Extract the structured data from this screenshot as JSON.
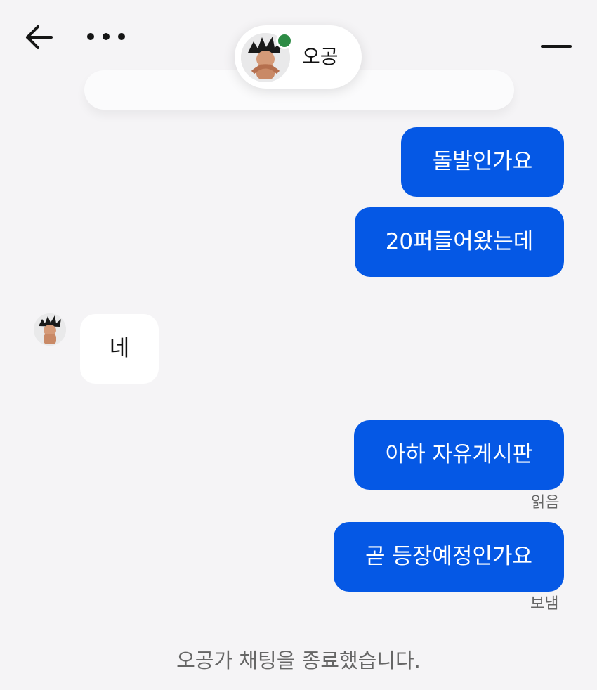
{
  "header": {
    "back_icon": "arrow-left-icon",
    "more_icon": "more-dots-icon",
    "minimize_icon": "minimize-icon",
    "profile": {
      "name": "오공",
      "online_color": "#2d8c45"
    }
  },
  "messages": [
    {
      "direction": "sent",
      "text": "돌발인가요"
    },
    {
      "direction": "sent",
      "text": "20퍼들어왔는데"
    },
    {
      "direction": "received",
      "text": "네"
    },
    {
      "direction": "sent",
      "text": "아하 자유게시판",
      "status": "읽음"
    },
    {
      "direction": "sent",
      "text": "곧 등장예정인가요",
      "status": "보냄"
    }
  ],
  "system_message": "오공가 채팅을 종료했습니다.",
  "colors": {
    "sent_bubble": "#0558e5",
    "received_bubble": "#ffffff",
    "background": "#f5f4f6",
    "status_text": "#666666"
  }
}
